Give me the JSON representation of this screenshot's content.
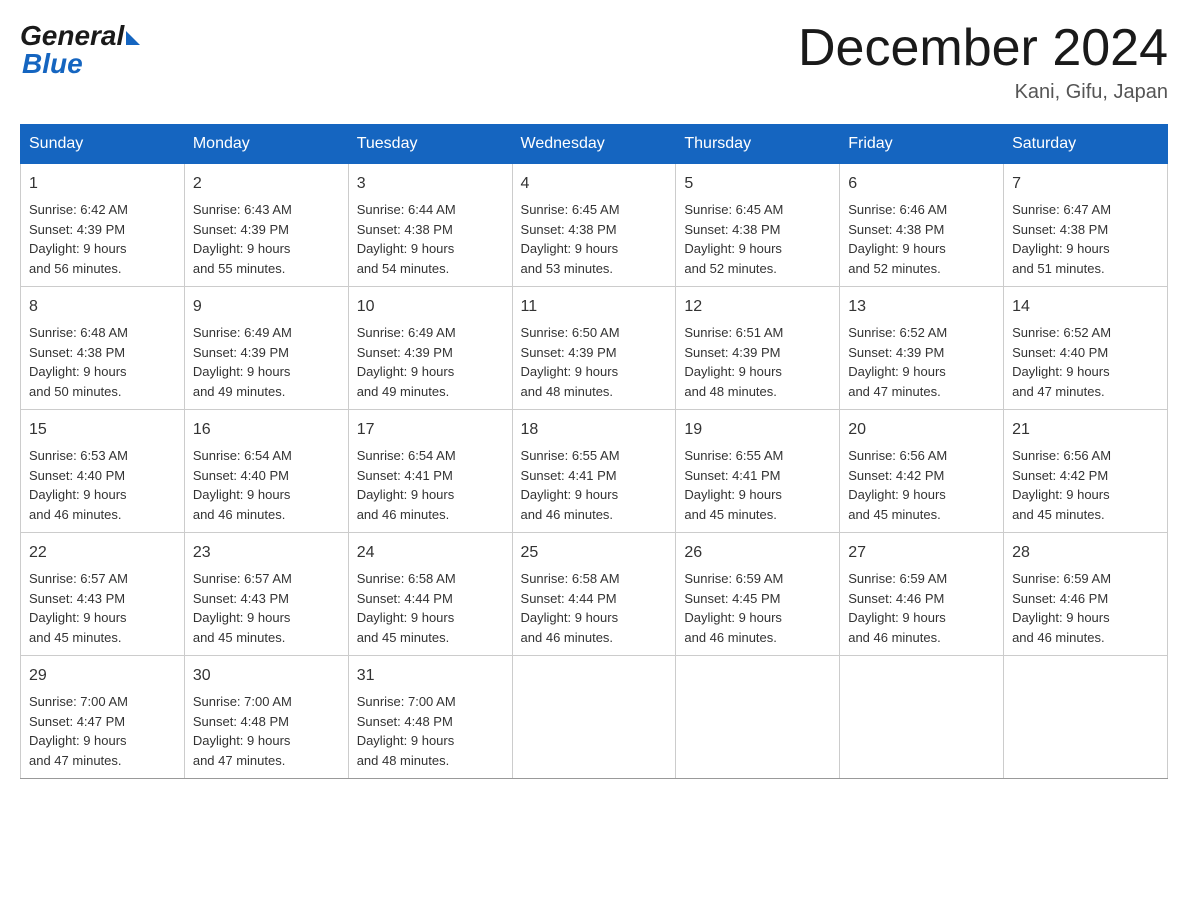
{
  "logo": {
    "general": "General",
    "blue": "Blue"
  },
  "title": {
    "month_year": "December 2024",
    "location": "Kani, Gifu, Japan"
  },
  "days_of_week": [
    "Sunday",
    "Monday",
    "Tuesday",
    "Wednesday",
    "Thursday",
    "Friday",
    "Saturday"
  ],
  "weeks": [
    [
      {
        "day": "1",
        "sunrise": "6:42 AM",
        "sunset": "4:39 PM",
        "daylight": "9 hours and 56 minutes."
      },
      {
        "day": "2",
        "sunrise": "6:43 AM",
        "sunset": "4:39 PM",
        "daylight": "9 hours and 55 minutes."
      },
      {
        "day": "3",
        "sunrise": "6:44 AM",
        "sunset": "4:38 PM",
        "daylight": "9 hours and 54 minutes."
      },
      {
        "day": "4",
        "sunrise": "6:45 AM",
        "sunset": "4:38 PM",
        "daylight": "9 hours and 53 minutes."
      },
      {
        "day": "5",
        "sunrise": "6:45 AM",
        "sunset": "4:38 PM",
        "daylight": "9 hours and 52 minutes."
      },
      {
        "day": "6",
        "sunrise": "6:46 AM",
        "sunset": "4:38 PM",
        "daylight": "9 hours and 52 minutes."
      },
      {
        "day": "7",
        "sunrise": "6:47 AM",
        "sunset": "4:38 PM",
        "daylight": "9 hours and 51 minutes."
      }
    ],
    [
      {
        "day": "8",
        "sunrise": "6:48 AM",
        "sunset": "4:38 PM",
        "daylight": "9 hours and 50 minutes."
      },
      {
        "day": "9",
        "sunrise": "6:49 AM",
        "sunset": "4:39 PM",
        "daylight": "9 hours and 49 minutes."
      },
      {
        "day": "10",
        "sunrise": "6:49 AM",
        "sunset": "4:39 PM",
        "daylight": "9 hours and 49 minutes."
      },
      {
        "day": "11",
        "sunrise": "6:50 AM",
        "sunset": "4:39 PM",
        "daylight": "9 hours and 48 minutes."
      },
      {
        "day": "12",
        "sunrise": "6:51 AM",
        "sunset": "4:39 PM",
        "daylight": "9 hours and 48 minutes."
      },
      {
        "day": "13",
        "sunrise": "6:52 AM",
        "sunset": "4:39 PM",
        "daylight": "9 hours and 47 minutes."
      },
      {
        "day": "14",
        "sunrise": "6:52 AM",
        "sunset": "4:40 PM",
        "daylight": "9 hours and 47 minutes."
      }
    ],
    [
      {
        "day": "15",
        "sunrise": "6:53 AM",
        "sunset": "4:40 PM",
        "daylight": "9 hours and 46 minutes."
      },
      {
        "day": "16",
        "sunrise": "6:54 AM",
        "sunset": "4:40 PM",
        "daylight": "9 hours and 46 minutes."
      },
      {
        "day": "17",
        "sunrise": "6:54 AM",
        "sunset": "4:41 PM",
        "daylight": "9 hours and 46 minutes."
      },
      {
        "day": "18",
        "sunrise": "6:55 AM",
        "sunset": "4:41 PM",
        "daylight": "9 hours and 46 minutes."
      },
      {
        "day": "19",
        "sunrise": "6:55 AM",
        "sunset": "4:41 PM",
        "daylight": "9 hours and 45 minutes."
      },
      {
        "day": "20",
        "sunrise": "6:56 AM",
        "sunset": "4:42 PM",
        "daylight": "9 hours and 45 minutes."
      },
      {
        "day": "21",
        "sunrise": "6:56 AM",
        "sunset": "4:42 PM",
        "daylight": "9 hours and 45 minutes."
      }
    ],
    [
      {
        "day": "22",
        "sunrise": "6:57 AM",
        "sunset": "4:43 PM",
        "daylight": "9 hours and 45 minutes."
      },
      {
        "day": "23",
        "sunrise": "6:57 AM",
        "sunset": "4:43 PM",
        "daylight": "9 hours and 45 minutes."
      },
      {
        "day": "24",
        "sunrise": "6:58 AM",
        "sunset": "4:44 PM",
        "daylight": "9 hours and 45 minutes."
      },
      {
        "day": "25",
        "sunrise": "6:58 AM",
        "sunset": "4:44 PM",
        "daylight": "9 hours and 46 minutes."
      },
      {
        "day": "26",
        "sunrise": "6:59 AM",
        "sunset": "4:45 PM",
        "daylight": "9 hours and 46 minutes."
      },
      {
        "day": "27",
        "sunrise": "6:59 AM",
        "sunset": "4:46 PM",
        "daylight": "9 hours and 46 minutes."
      },
      {
        "day": "28",
        "sunrise": "6:59 AM",
        "sunset": "4:46 PM",
        "daylight": "9 hours and 46 minutes."
      }
    ],
    [
      {
        "day": "29",
        "sunrise": "7:00 AM",
        "sunset": "4:47 PM",
        "daylight": "9 hours and 47 minutes."
      },
      {
        "day": "30",
        "sunrise": "7:00 AM",
        "sunset": "4:48 PM",
        "daylight": "9 hours and 47 minutes."
      },
      {
        "day": "31",
        "sunrise": "7:00 AM",
        "sunset": "4:48 PM",
        "daylight": "9 hours and 48 minutes."
      },
      null,
      null,
      null,
      null
    ]
  ],
  "labels": {
    "sunrise": "Sunrise:",
    "sunset": "Sunset:",
    "daylight": "Daylight:"
  }
}
